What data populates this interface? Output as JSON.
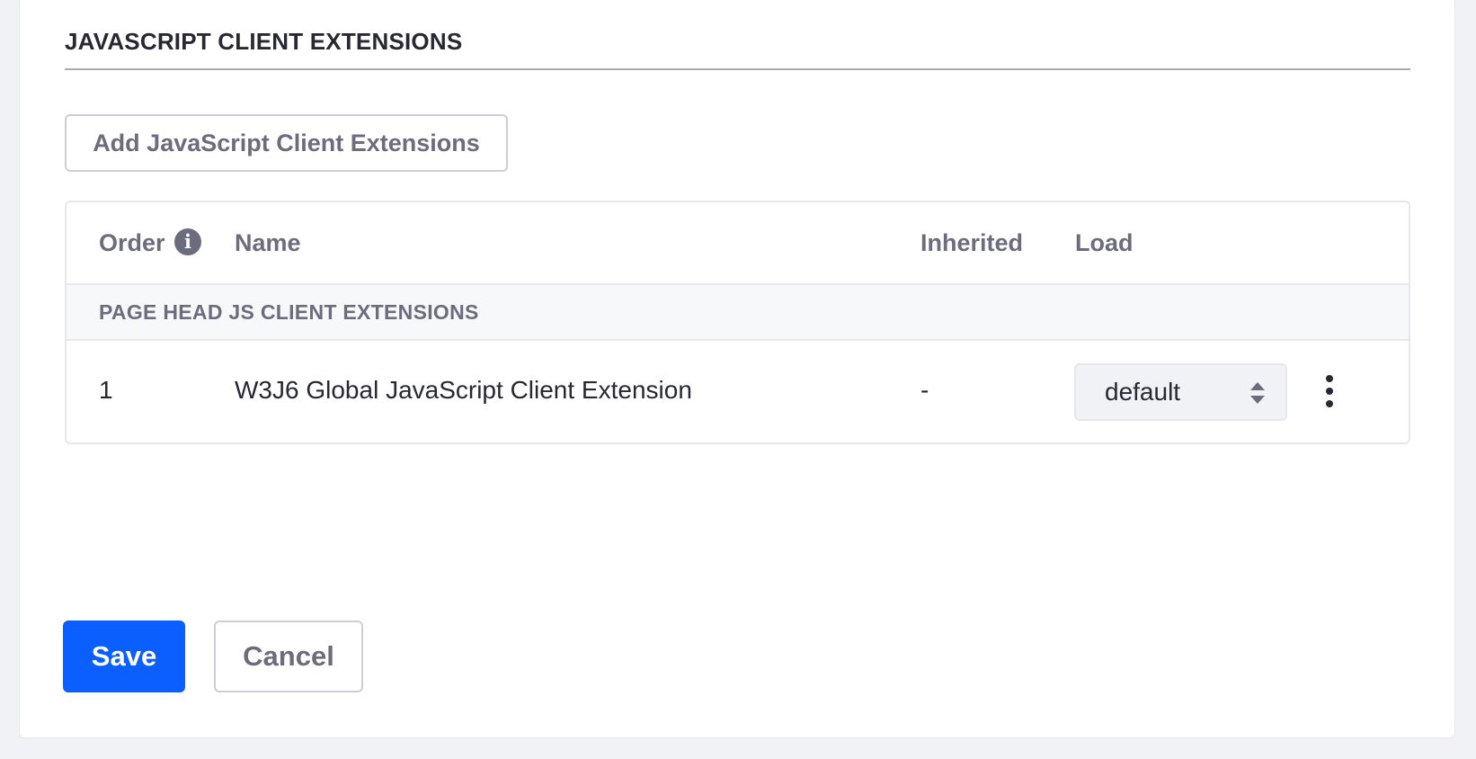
{
  "section": {
    "title": "JAVASCRIPT CLIENT EXTENSIONS"
  },
  "actions": {
    "add_label": "Add JavaScript Client Extensions"
  },
  "table": {
    "columns": {
      "order": "Order",
      "name": "Name",
      "inherited": "Inherited",
      "load": "Load"
    },
    "info_icon_glyph": "i",
    "groups": [
      {
        "label": "PAGE HEAD JS CLIENT EXTENSIONS",
        "rows": [
          {
            "order": "1",
            "name": "W3J6 Global JavaScript Client Extension",
            "inherited": "-",
            "load": "default"
          }
        ]
      }
    ]
  },
  "footer": {
    "save_label": "Save",
    "cancel_label": "Cancel"
  },
  "icons": {
    "info": "info-circle-icon",
    "select_caret": "caret-double-icon",
    "row_actions": "ellipsis-v-icon"
  },
  "colors": {
    "primary": "#0b5fff",
    "text_secondary": "#6b6c7e",
    "text_primary": "#272833",
    "page_background": "#f1f2f5"
  }
}
